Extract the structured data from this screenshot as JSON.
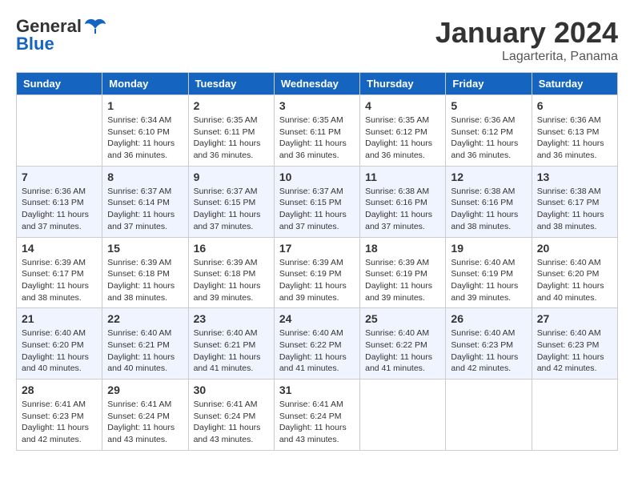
{
  "header": {
    "logo_general": "General",
    "logo_blue": "Blue",
    "month_title": "January 2024",
    "location": "Lagarterita, Panama"
  },
  "days_of_week": [
    "Sunday",
    "Monday",
    "Tuesday",
    "Wednesday",
    "Thursday",
    "Friday",
    "Saturday"
  ],
  "weeks": [
    [
      {
        "day": "",
        "info": ""
      },
      {
        "day": "1",
        "info": "Sunrise: 6:34 AM\nSunset: 6:10 PM\nDaylight: 11 hours and 36 minutes."
      },
      {
        "day": "2",
        "info": "Sunrise: 6:35 AM\nSunset: 6:11 PM\nDaylight: 11 hours and 36 minutes."
      },
      {
        "day": "3",
        "info": "Sunrise: 6:35 AM\nSunset: 6:11 PM\nDaylight: 11 hours and 36 minutes."
      },
      {
        "day": "4",
        "info": "Sunrise: 6:35 AM\nSunset: 6:12 PM\nDaylight: 11 hours and 36 minutes."
      },
      {
        "day": "5",
        "info": "Sunrise: 6:36 AM\nSunset: 6:12 PM\nDaylight: 11 hours and 36 minutes."
      },
      {
        "day": "6",
        "info": "Sunrise: 6:36 AM\nSunset: 6:13 PM\nDaylight: 11 hours and 36 minutes."
      }
    ],
    [
      {
        "day": "7",
        "info": "Sunrise: 6:36 AM\nSunset: 6:13 PM\nDaylight: 11 hours and 37 minutes."
      },
      {
        "day": "8",
        "info": "Sunrise: 6:37 AM\nSunset: 6:14 PM\nDaylight: 11 hours and 37 minutes."
      },
      {
        "day": "9",
        "info": "Sunrise: 6:37 AM\nSunset: 6:15 PM\nDaylight: 11 hours and 37 minutes."
      },
      {
        "day": "10",
        "info": "Sunrise: 6:37 AM\nSunset: 6:15 PM\nDaylight: 11 hours and 37 minutes."
      },
      {
        "day": "11",
        "info": "Sunrise: 6:38 AM\nSunset: 6:16 PM\nDaylight: 11 hours and 37 minutes."
      },
      {
        "day": "12",
        "info": "Sunrise: 6:38 AM\nSunset: 6:16 PM\nDaylight: 11 hours and 38 minutes."
      },
      {
        "day": "13",
        "info": "Sunrise: 6:38 AM\nSunset: 6:17 PM\nDaylight: 11 hours and 38 minutes."
      }
    ],
    [
      {
        "day": "14",
        "info": "Sunrise: 6:39 AM\nSunset: 6:17 PM\nDaylight: 11 hours and 38 minutes."
      },
      {
        "day": "15",
        "info": "Sunrise: 6:39 AM\nSunset: 6:18 PM\nDaylight: 11 hours and 38 minutes."
      },
      {
        "day": "16",
        "info": "Sunrise: 6:39 AM\nSunset: 6:18 PM\nDaylight: 11 hours and 39 minutes."
      },
      {
        "day": "17",
        "info": "Sunrise: 6:39 AM\nSunset: 6:19 PM\nDaylight: 11 hours and 39 minutes."
      },
      {
        "day": "18",
        "info": "Sunrise: 6:39 AM\nSunset: 6:19 PM\nDaylight: 11 hours and 39 minutes."
      },
      {
        "day": "19",
        "info": "Sunrise: 6:40 AM\nSunset: 6:19 PM\nDaylight: 11 hours and 39 minutes."
      },
      {
        "day": "20",
        "info": "Sunrise: 6:40 AM\nSunset: 6:20 PM\nDaylight: 11 hours and 40 minutes."
      }
    ],
    [
      {
        "day": "21",
        "info": "Sunrise: 6:40 AM\nSunset: 6:20 PM\nDaylight: 11 hours and 40 minutes."
      },
      {
        "day": "22",
        "info": "Sunrise: 6:40 AM\nSunset: 6:21 PM\nDaylight: 11 hours and 40 minutes."
      },
      {
        "day": "23",
        "info": "Sunrise: 6:40 AM\nSunset: 6:21 PM\nDaylight: 11 hours and 41 minutes."
      },
      {
        "day": "24",
        "info": "Sunrise: 6:40 AM\nSunset: 6:22 PM\nDaylight: 11 hours and 41 minutes."
      },
      {
        "day": "25",
        "info": "Sunrise: 6:40 AM\nSunset: 6:22 PM\nDaylight: 11 hours and 41 minutes."
      },
      {
        "day": "26",
        "info": "Sunrise: 6:40 AM\nSunset: 6:23 PM\nDaylight: 11 hours and 42 minutes."
      },
      {
        "day": "27",
        "info": "Sunrise: 6:40 AM\nSunset: 6:23 PM\nDaylight: 11 hours and 42 minutes."
      }
    ],
    [
      {
        "day": "28",
        "info": "Sunrise: 6:41 AM\nSunset: 6:23 PM\nDaylight: 11 hours and 42 minutes."
      },
      {
        "day": "29",
        "info": "Sunrise: 6:41 AM\nSunset: 6:24 PM\nDaylight: 11 hours and 43 minutes."
      },
      {
        "day": "30",
        "info": "Sunrise: 6:41 AM\nSunset: 6:24 PM\nDaylight: 11 hours and 43 minutes."
      },
      {
        "day": "31",
        "info": "Sunrise: 6:41 AM\nSunset: 6:24 PM\nDaylight: 11 hours and 43 minutes."
      },
      {
        "day": "",
        "info": ""
      },
      {
        "day": "",
        "info": ""
      },
      {
        "day": "",
        "info": ""
      }
    ]
  ]
}
